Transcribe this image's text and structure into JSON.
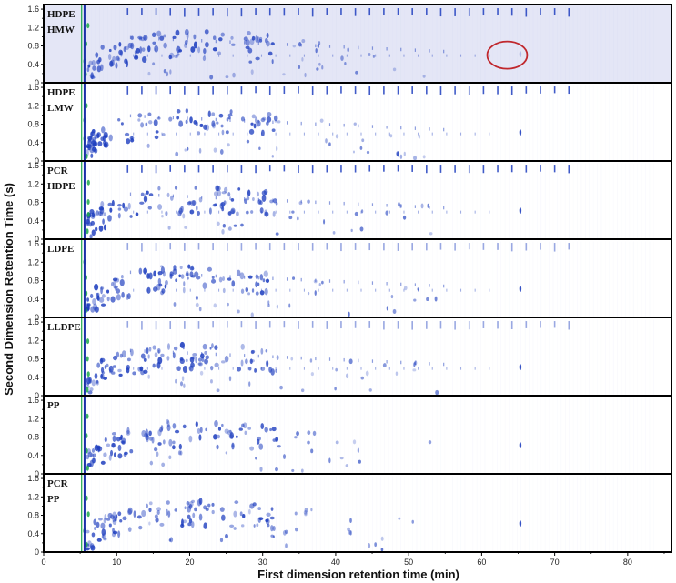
{
  "chart_data": {
    "type": "heatmap",
    "title": "",
    "xlabel": "First dimension retention time (min)",
    "ylabel": "Second Dimension Retention Time (s)",
    "xlim": [
      0,
      86
    ],
    "ylim": [
      0,
      1.7
    ],
    "x_ticks": [
      0,
      10,
      20,
      30,
      40,
      50,
      60,
      70,
      80
    ],
    "y_ticks": [
      0,
      0.4,
      0.8,
      1.2,
      1.6
    ],
    "y_minor_ticks": [
      0.2,
      0.6,
      1.0,
      1.4
    ],
    "panels": [
      {
        "name": "HDPE HMW",
        "label_lines": [
          "HDPE",
          "HMW"
        ],
        "shaded": true,
        "annotation": {
          "type": "circle",
          "x": 63.5,
          "y": 0.6
        }
      },
      {
        "name": "HDPE LMW",
        "label_lines": [
          "HDPE",
          "LMW"
        ],
        "shaded": false
      },
      {
        "name": "PCR HDPE",
        "label_lines": [
          "PCR",
          "HDPE"
        ],
        "shaded": false
      },
      {
        "name": "LDPE",
        "label_lines": [
          "LDPE"
        ],
        "shaded": false
      },
      {
        "name": "LLDPE",
        "label_lines": [
          "LLDPE"
        ],
        "shaded": false
      },
      {
        "name": "PP",
        "label_lines": [
          "PP"
        ],
        "shaded": false
      },
      {
        "name": "PCR PP",
        "label_lines": [
          "PCR",
          "PP"
        ],
        "shaded": false
      }
    ],
    "colors": {
      "panel_shade": "#e4e6f6",
      "peak": "#1f3fbf",
      "peak_faint": "#aab4e6",
      "hot_peak": "#1aa84a",
      "solvent_line": "#1a2fa8",
      "annotation": "#c0272d",
      "frame": "#000000"
    }
  }
}
